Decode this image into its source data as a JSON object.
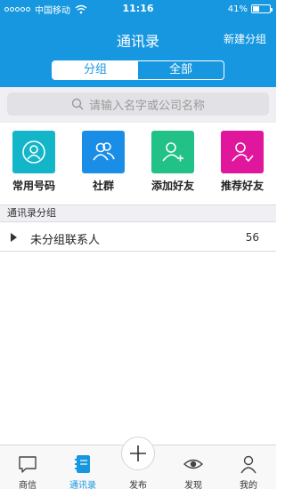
{
  "status_bar": {
    "carrier": "中国移动",
    "time": "11:16",
    "battery_percent_label": "41%",
    "battery_level": 0.41
  },
  "nav": {
    "title": "通讯录",
    "action_label": "新建分组"
  },
  "segmented": {
    "options": [
      "分组",
      "全部"
    ],
    "selected": "分组"
  },
  "search": {
    "placeholder": "请输入名字或公司名称"
  },
  "shortcuts": [
    {
      "label": "常用号码",
      "icon": "person-circle-icon",
      "color": "#13b5c8"
    },
    {
      "label": "社群",
      "icon": "group-icon",
      "color": "#1a8ee6"
    },
    {
      "label": "添加好友",
      "icon": "add-friend-icon",
      "color": "#22c188"
    },
    {
      "label": "推荐好友",
      "icon": "recommend-friend-icon",
      "color": "#e0169c"
    }
  ],
  "section": {
    "title": "通讯录分组"
  },
  "groups": [
    {
      "name": "未分组联系人",
      "count": "56"
    }
  ],
  "tabbar": {
    "tabs": [
      {
        "label": "商信",
        "icon": "chat-bubble-icon"
      },
      {
        "label": "通讯录",
        "icon": "contacts-book-icon",
        "active": true
      },
      {
        "label": "发布",
        "icon": "plus-icon"
      },
      {
        "label": "发现",
        "icon": "eye-icon"
      },
      {
        "label": "我的",
        "icon": "person-icon"
      }
    ]
  },
  "colors": {
    "primary": "#1797e0",
    "background": "#efeff4"
  }
}
